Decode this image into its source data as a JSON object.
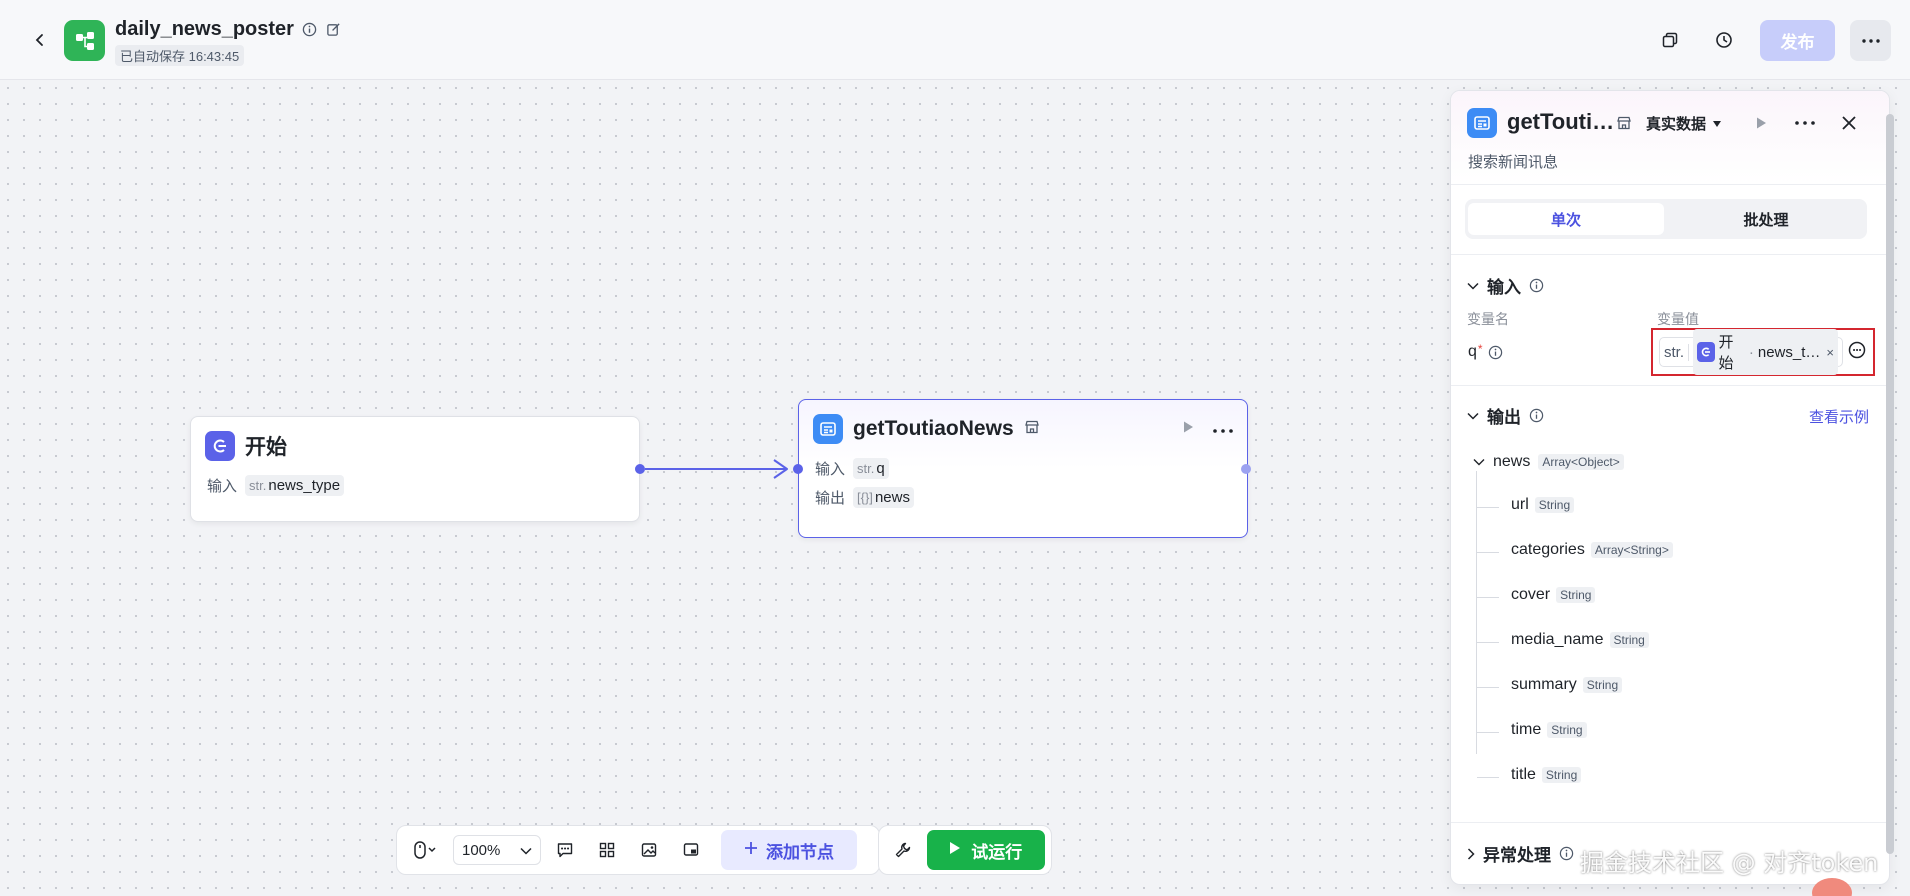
{
  "header": {
    "title": "daily_news_poster",
    "autosave": "已自动保存 16:43:45",
    "publish_label": "发布"
  },
  "canvas": {
    "start_node": {
      "title": "开始",
      "row_label": "输入",
      "param_type": "str.",
      "param_name": "news_type"
    },
    "news_node": {
      "title": "getToutiaoNews",
      "input_label": "输入",
      "input_type": "str.",
      "input_name": "q",
      "output_label": "输出",
      "output_type": "[{}]",
      "output_name": "news"
    }
  },
  "toolbar": {
    "zoom": "100%",
    "add_node_label": "添加节点",
    "run_label": "试运行"
  },
  "panel": {
    "title": "getTouti…",
    "mode": "真实数据",
    "description": "搜索新闻讯息",
    "tabs": [
      "单次",
      "批处理"
    ],
    "input_section": "输入",
    "col_var_name": "变量名",
    "col_var_value": "变量值",
    "var_name": "q",
    "var_required": "*",
    "var_type": "str.",
    "var_ref_node": "开始",
    "var_ref_sep": "·",
    "var_ref_value": "news_t…",
    "output_section": "输出",
    "view_example": "查看示例",
    "output_root": "news",
    "output_root_type": "Array<Object>",
    "output_fields": [
      {
        "name": "url",
        "type": "String"
      },
      {
        "name": "categories",
        "type": "Array<String>"
      },
      {
        "name": "cover",
        "type": "String"
      },
      {
        "name": "media_name",
        "type": "String"
      },
      {
        "name": "summary",
        "type": "String"
      },
      {
        "name": "time",
        "type": "String"
      },
      {
        "name": "title",
        "type": "String"
      }
    ],
    "exception_section": "异常处理"
  },
  "watermark": "掘金技术社区 @ 对齐token",
  "colors": {
    "accent": "#5b62e8",
    "run_green": "#18b24a",
    "publish_disabled": "#c7cdfa",
    "highlight_red": "#d4262f",
    "app_icon_green": "#2fb457"
  },
  "icons": [
    "back-icon",
    "app-logo-icon",
    "info-icon",
    "edit-icon",
    "copy-icon",
    "history-icon",
    "more-icon",
    "start-node-icon",
    "plugin-node-icon",
    "store-icon",
    "play-icon",
    "close-icon",
    "chevron-down-icon",
    "mouse-icon",
    "comment-icon",
    "grid-icon",
    "image-icon",
    "minimap-icon",
    "plus-icon",
    "wrench-icon",
    "variable-picker-icon"
  ]
}
